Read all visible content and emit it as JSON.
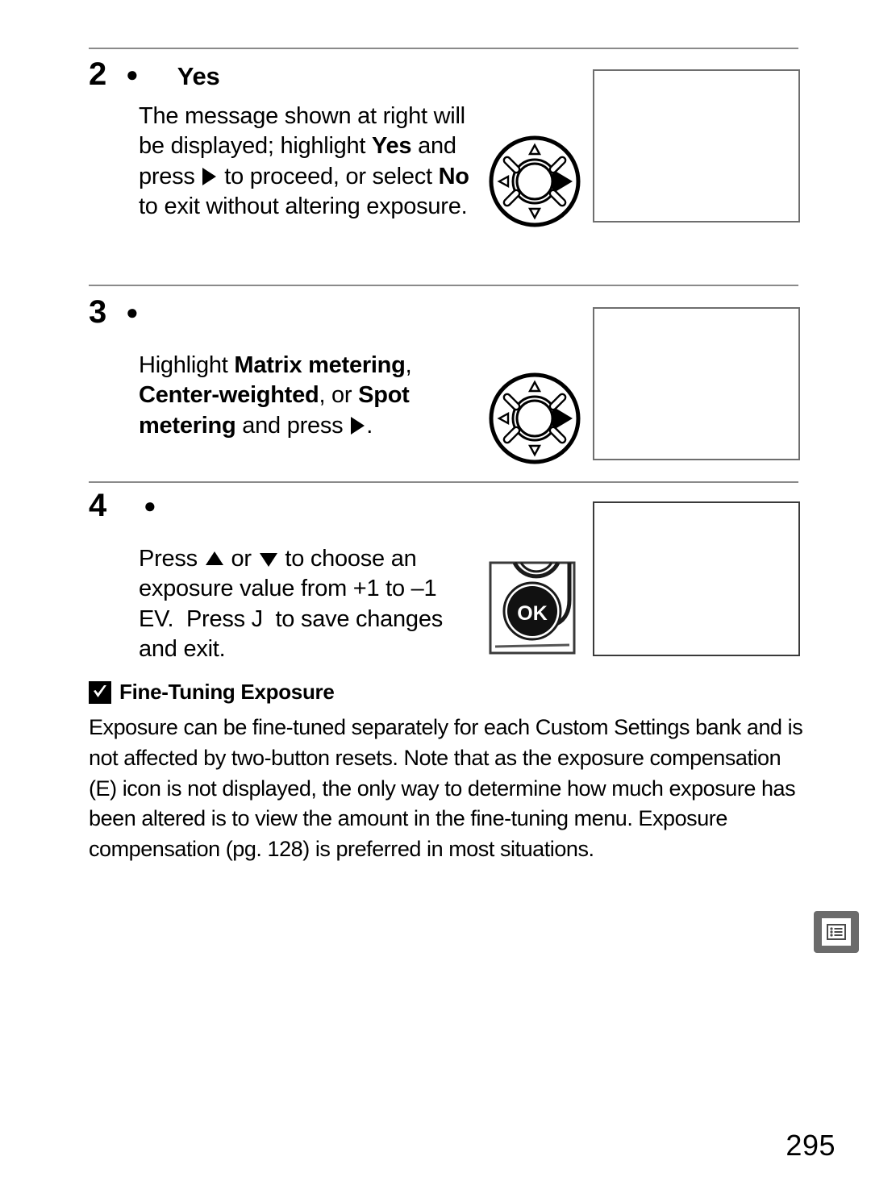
{
  "page": {
    "number": "295"
  },
  "steps": [
    {
      "number": "2",
      "glyph": "●",
      "glyph_name": "filled-circle-glyph",
      "title": "Yes",
      "body_html": "The message shown at right will be displayed; highlight <b>Yes</b> and press ▶ to proceed, or select <b>No</b> to exit without altering exposure.",
      "body_plain": "The message shown at right will be displayed; highlight Yes and press ▶ to proceed, or select No to exit without altering exposure."
    },
    {
      "number": "3",
      "glyph": "●",
      "glyph_name": "filled-circle-glyph",
      "title": "",
      "body_html": "Highlight <b>Matrix metering</b>, <b>Center-weighted</b>, or <b>Spot metering</b> and press ▶.",
      "body_plain": "Highlight Matrix metering, Center-weighted, or Spot metering and press ▶."
    },
    {
      "number": "4",
      "glyph": "●",
      "glyph_name": "filled-circle-glyph",
      "title": "",
      "body_html": "Press ▲ or ▼ to choose an exposure value from +1 to –1 EV.  Press J  to save changes and exit.",
      "body_plain": "Press ▲ or ▼ to choose an exposure value from +1 to –1 EV. Press J to save changes and exit."
    }
  ],
  "note": {
    "title": "Fine-Tuning Exposure",
    "badge_icon": "checkmark-icon",
    "body": "Exposure can be fine-tuned separately for each Custom Settings bank and is not affected by two-button resets.  Note that as the exposure compensation (E) icon is not displayed, the only way to determine how much exposure has been altered is to view the amount in the fine-tuning menu.  Exposure compensation (pg. 128) is preferred in most situations."
  },
  "figures": {
    "dial_label": "multi-selector-dial",
    "ok_button_label": "OK",
    "screen_placeholder_label": "camera-screen-illustration"
  },
  "tab_marker": {
    "icon": "menu-list-icon"
  },
  "colors": {
    "rule": "#8a8a8a",
    "screen_border": "#6e6e6e",
    "tab_marker": "#6b6b6b",
    "text": "#000000",
    "background": "#ffffff"
  }
}
